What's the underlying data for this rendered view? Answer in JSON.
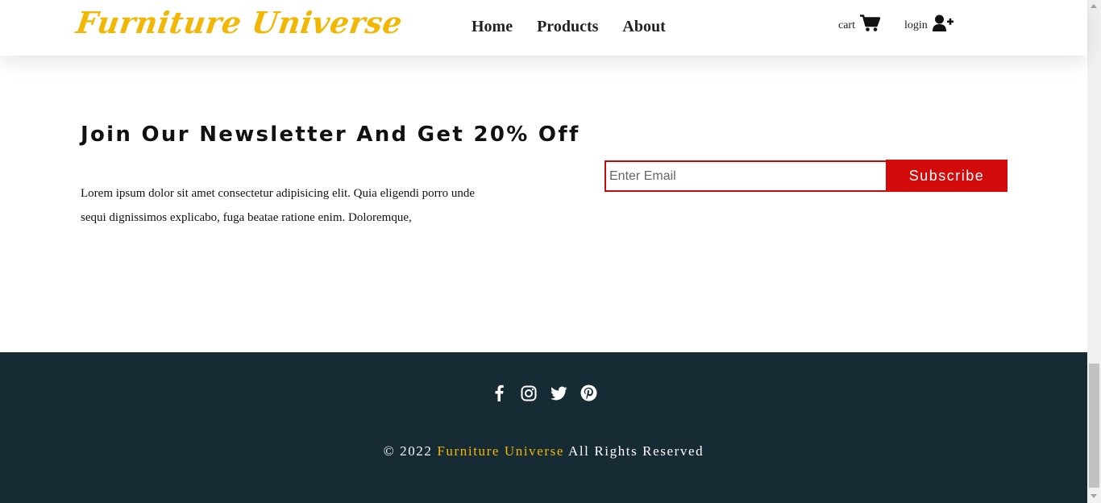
{
  "header": {
    "logo": "Furniture Universe",
    "nav": [
      "Home",
      "Products",
      "About"
    ],
    "cart_label": "cart",
    "login_label": "login"
  },
  "newsletter": {
    "title": "Join Our Newsletter And Get 20% Off",
    "text": "Lorem ipsum dolor sit amet consectetur adipisicing elit. Quia eligendi porro unde sequi dignissimos explicabo, fuga beatae ratione enim. Doloremque,",
    "email_placeholder": "Enter Email",
    "subscribe_label": "Subscribe"
  },
  "footer": {
    "socials": [
      "facebook-icon",
      "instagram-icon",
      "twitter-icon",
      "pinterest-icon"
    ],
    "copyright_prefix": "© 2022 ",
    "copyright_brand": "Furniture Universe",
    "copyright_suffix": " All Rights Reserved"
  },
  "colors": {
    "brand_yellow": "#f2b705",
    "accent_red": "#d30a0a",
    "footer_bg": "#172b34"
  }
}
